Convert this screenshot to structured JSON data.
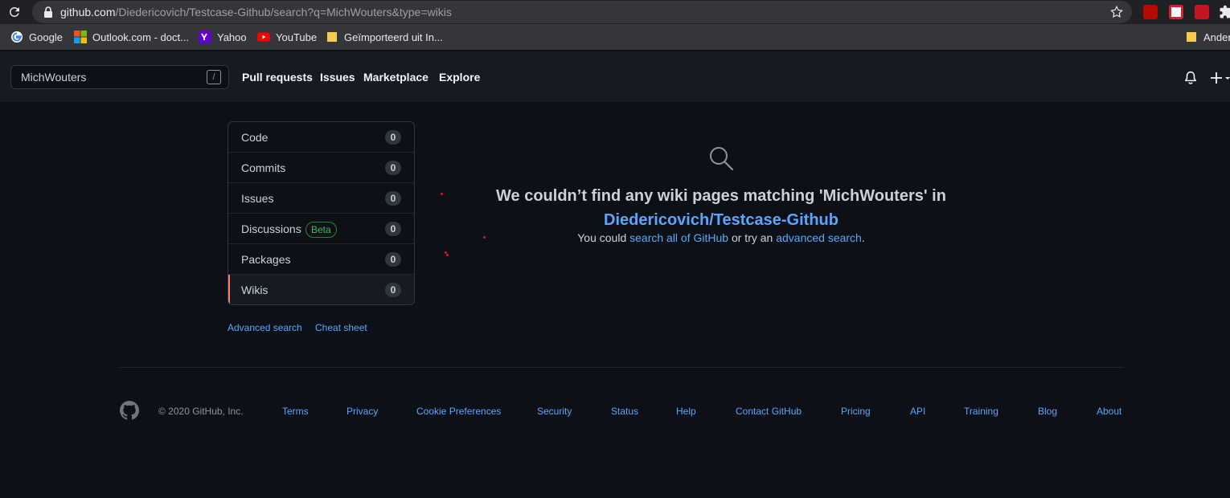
{
  "browser": {
    "url_host": "github.com",
    "url_path": "/Diedericovich/Testcase-Github/search?q=MichWouters&type=wikis",
    "bookmarks": [
      {
        "label": "Google",
        "icon": "google-icon"
      },
      {
        "label": "Outlook.com - doct...",
        "icon": "microsoft-icon"
      },
      {
        "label": "Yahoo",
        "icon": "yahoo-icon"
      },
      {
        "label": "YouTube",
        "icon": "youtube-icon"
      },
      {
        "label": "Geïmporteerd uit In...",
        "icon": "folder-icon"
      },
      {
        "label": "Ander",
        "icon": "folder-icon"
      }
    ]
  },
  "header": {
    "search_value": "MichWouters",
    "slash_hint": "/",
    "nav": [
      "Pull requests",
      "Issues",
      "Marketplace",
      "Explore"
    ]
  },
  "menu": {
    "items": [
      {
        "label": "Code",
        "count": "0"
      },
      {
        "label": "Commits",
        "count": "0"
      },
      {
        "label": "Issues",
        "count": "0"
      },
      {
        "label": "Discussions",
        "count": "0",
        "badge": "Beta"
      },
      {
        "label": "Packages",
        "count": "0"
      },
      {
        "label": "Wikis",
        "count": "0"
      }
    ],
    "selected": "Wikis",
    "advanced_search": "Advanced search",
    "cheat_sheet": "Cheat sheet"
  },
  "blankslate": {
    "title": "We couldn’t find any wiki pages matching 'MichWouters' in",
    "repo": "Diedericovich/Testcase-Github",
    "sub_prefix": "You could",
    "sub_link1": "search all of GitHub",
    "sub_mid": "or try an",
    "sub_link2": "advanced search",
    "sub_suffix": "."
  },
  "footer": {
    "copyright": "© 2020 GitHub, Inc.",
    "links": [
      "Terms",
      "Privacy",
      "Cookie Preferences",
      "Security",
      "Status",
      "Help",
      "Contact GitHub",
      "Pricing",
      "API",
      "Training",
      "Blog",
      "About"
    ]
  },
  "colors": {
    "background": "#0d1117",
    "header": "#161b22",
    "link": "#58a6ff",
    "selected_accent": "#f78166",
    "beta": "#3fb950"
  }
}
